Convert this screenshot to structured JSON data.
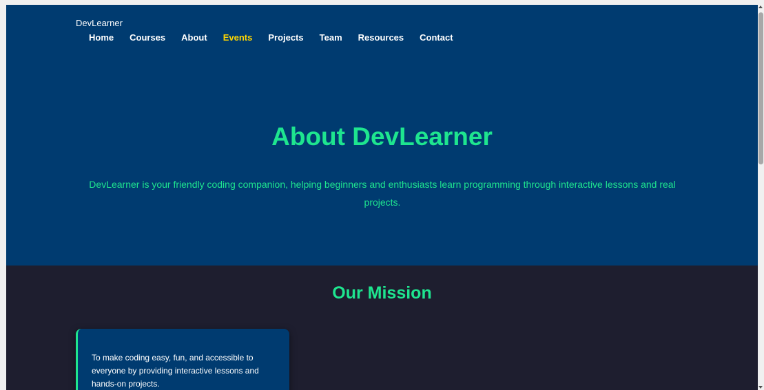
{
  "brand": "DevLearner",
  "nav": [
    {
      "label": "Home",
      "active": false
    },
    {
      "label": "Courses",
      "active": false
    },
    {
      "label": "About",
      "active": false
    },
    {
      "label": "Events",
      "active": true
    },
    {
      "label": "Projects",
      "active": false
    },
    {
      "label": "Team",
      "active": false
    },
    {
      "label": "Resources",
      "active": false
    },
    {
      "label": "Contact",
      "active": false
    }
  ],
  "hero": {
    "title": "About DevLearner",
    "text": "DevLearner is your friendly coding companion, helping beginners and enthusiasts learn programming through interactive lessons and real projects."
  },
  "mission": {
    "title": "Our Mission",
    "card_text": "To make coding easy, fun, and accessible to everyone by providing interactive lessons and hands-on projects."
  },
  "colors": {
    "hero_bg": "#003b70",
    "page_bg": "#1e1e2f",
    "accent_green": "#1ee58f",
    "active_nav": "#ffd600"
  },
  "scrollbar": {
    "up_icon": "triangle-up-icon",
    "down_icon": "triangle-down-icon"
  }
}
